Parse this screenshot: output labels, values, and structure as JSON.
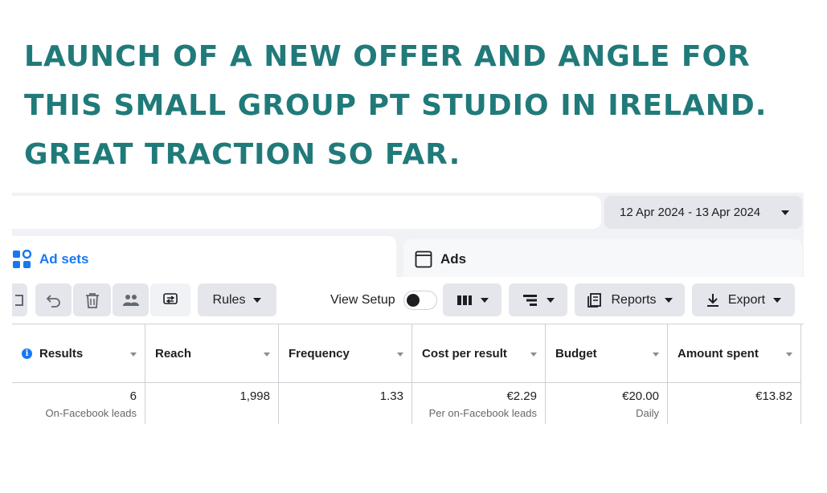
{
  "headline": "LAUNCH OF A NEW OFFER AND ANGLE FOR THIS SMALL GROUP PT STUDIO IN IRELAND. GREAT TRACTION SO FAR.",
  "date_range": "12 Apr 2024 - 13 Apr 2024",
  "tabs": {
    "ad_sets": "Ad sets",
    "ads": "Ads"
  },
  "toolbar": {
    "rules": "Rules",
    "view_setup": "View Setup",
    "view_setup_on": false,
    "reports": "Reports",
    "export": "Export"
  },
  "icons": {
    "ad_sets": "grid-icon",
    "ads": "window-icon",
    "undo": "undo-icon",
    "delete": "trash-icon",
    "audience": "people-icon",
    "ab_test": "ab-test-icon",
    "columns": "columns-icon",
    "breakdown": "breakdown-icon",
    "reports": "reports-icon",
    "export": "download-icon"
  },
  "colors": {
    "headline": "#217a7a",
    "accent": "#1877f2"
  },
  "table": {
    "columns": [
      "Results",
      "Reach",
      "Frequency",
      "Cost per result",
      "Budget",
      "Amount spent"
    ],
    "row": {
      "results": "6",
      "results_sub": "On-Facebook leads",
      "reach": "1,998",
      "frequency": "1.33",
      "cost_per_result": "€2.29",
      "cost_per_result_sub": "Per on-Facebook leads",
      "budget": "€20.00",
      "budget_sub": "Daily",
      "amount_spent": "€13.82"
    }
  }
}
